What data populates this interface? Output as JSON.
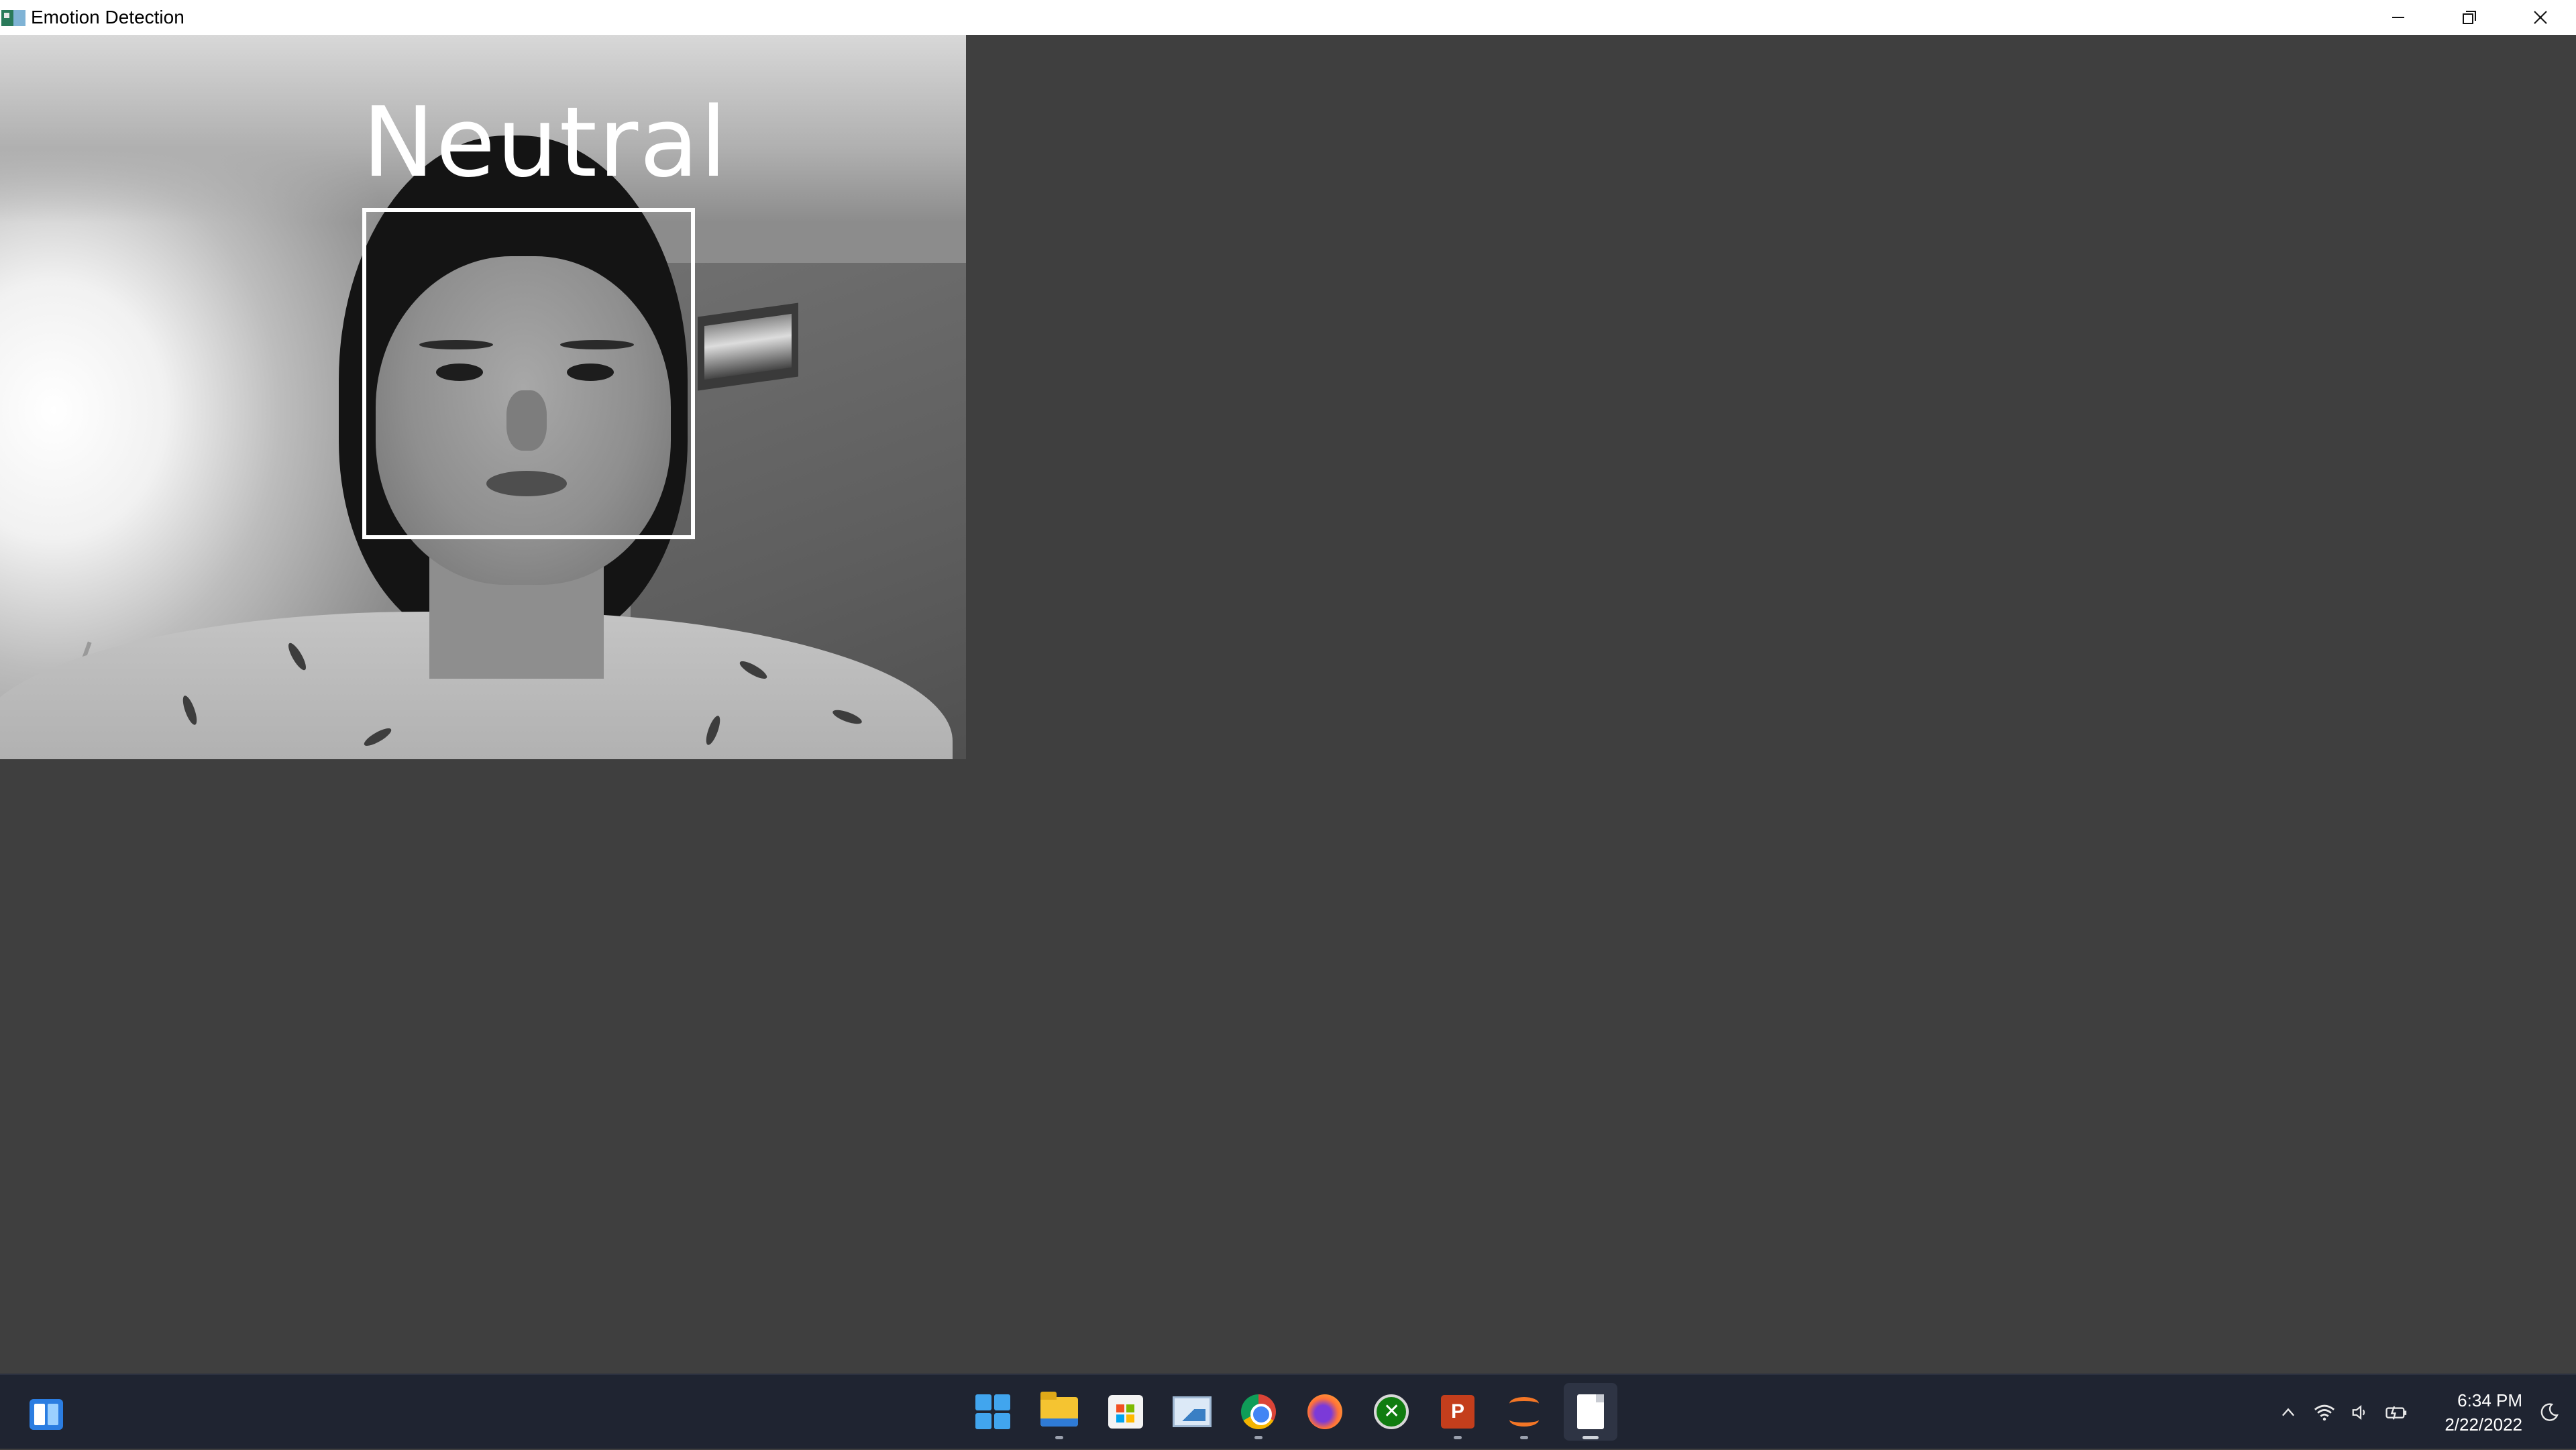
{
  "window": {
    "title": "Emotion Detection",
    "controls": {
      "minimize_icon": "minimize-icon",
      "restore_icon": "restore-icon",
      "close_icon": "close-icon"
    }
  },
  "detection": {
    "label": "Neutral",
    "box_color": "#ffffff"
  },
  "taskbar": {
    "background": "#1f2431",
    "apps": [
      {
        "name": "start",
        "icon": "windows-start-icon"
      },
      {
        "name": "file-explorer",
        "icon": "folder-icon"
      },
      {
        "name": "microsoft-store",
        "icon": "store-icon"
      },
      {
        "name": "photos",
        "icon": "photos-icon"
      },
      {
        "name": "chrome",
        "icon": "chrome-icon"
      },
      {
        "name": "firefox",
        "icon": "firefox-icon"
      },
      {
        "name": "xbox",
        "icon": "xbox-icon"
      },
      {
        "name": "powerpoint",
        "icon": "powerpoint-icon"
      },
      {
        "name": "jupyter",
        "icon": "jupyter-icon"
      },
      {
        "name": "document",
        "icon": "document-icon"
      }
    ],
    "ppt_letter": "P",
    "tray": {
      "chevron": "^",
      "wifi": "wifi-icon",
      "volume": "volume-icon",
      "battery": "battery-icon"
    },
    "clock": {
      "time": "6:34 PM",
      "date": "2/22/2022"
    }
  }
}
